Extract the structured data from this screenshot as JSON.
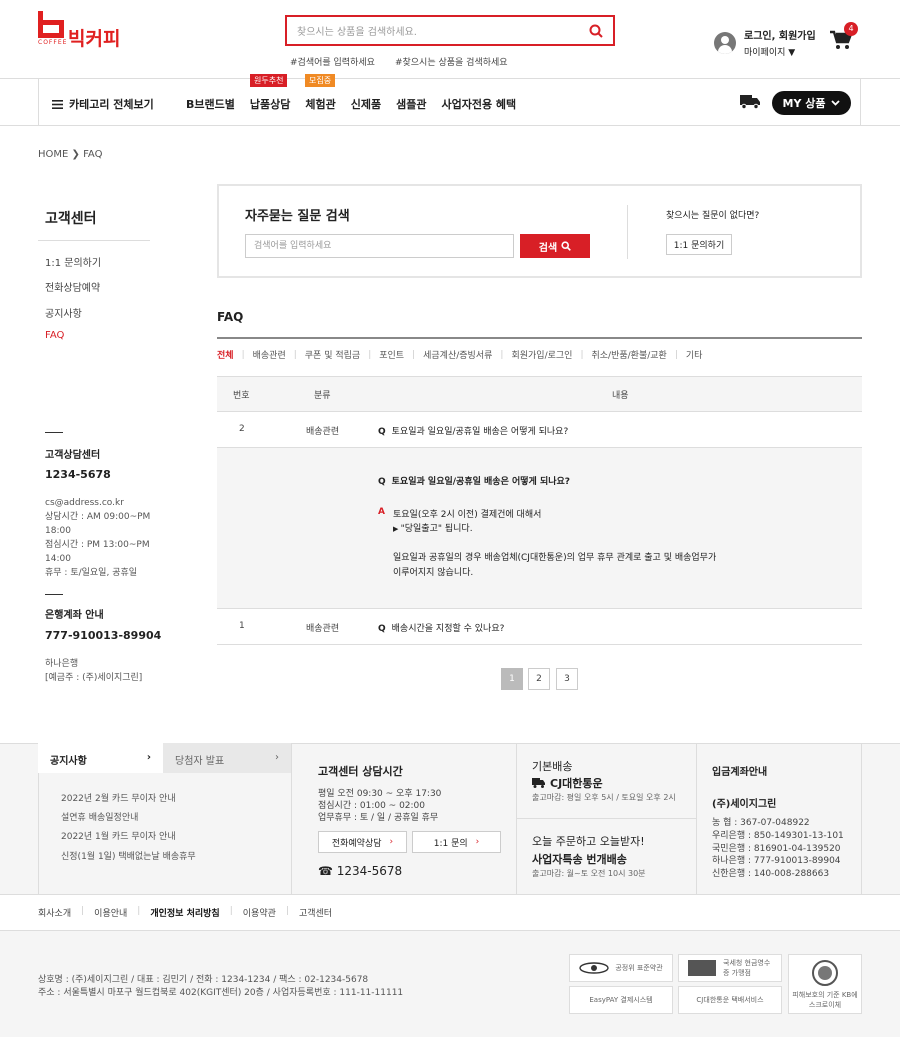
{
  "header": {
    "logo_sub": "COFFEE",
    "logo_name": "빅커피",
    "search_placeholder": "찾으시는 상품을 검색하세요.",
    "tag1": "#검색어를 입력하세요",
    "tag2": "#찾으시는 상품을 검색하세요",
    "login": "로그인, 회원가입",
    "mypage": "마이페이지 ▼",
    "cart_count": "4"
  },
  "nav": {
    "category_all": "카테고리 전체보기",
    "items": [
      "B브랜드별",
      "납품상담",
      "체험관",
      "신제품",
      "샘플관",
      "사업자전용 혜택"
    ],
    "badge1": "원두추천",
    "badge2": "모집중",
    "my": "MY 상품"
  },
  "breadcrumb": "HOME  ❯  FAQ",
  "sidebar": {
    "title": "고객센터",
    "items": [
      "1:1 문의하기",
      "전화상담예약",
      "공지사항",
      "FAQ"
    ],
    "cs_title": "고객상담센터",
    "cs_phone": "1234-5678",
    "cs_email": "cs@address.co.kr",
    "cs_hours1": "상담시간 : AM 09:00~PM 18:00",
    "cs_hours2": "점심시간 : PM 13:00~PM 14:00",
    "cs_holiday": "휴무 : 토/일요일, 공휴일",
    "bank_title": "은행계좌 안내",
    "bank_no": "777-910013-89904",
    "bank_name": "하나은행",
    "bank_holder": "[예금주 : (주)세이지그린]"
  },
  "faq_search": {
    "title": "자주묻는 질문 검색",
    "placeholder": "검색어를 입력하세요",
    "btn": "검색",
    "q": "찾으시는 질문이 없다면?",
    "ask": "1:1 문의하기"
  },
  "faq": {
    "title": "FAQ",
    "tabs": [
      "전체",
      "배송관련",
      "쿠폰 및 적립금",
      "포인트",
      "세금계산/증빙서류",
      "회원가입/로그인",
      "취소/반품/환불/교환",
      "기타"
    ],
    "cols": [
      "번호",
      "분류",
      "내용"
    ],
    "rows": [
      {
        "no": "2",
        "cat": "배송관련",
        "q": "토요일과 일요일/공휴일 배송은 어떻게 되나요?"
      },
      {
        "no": "1",
        "cat": "배송관련",
        "q": "배송시간을 지정할 수 있나요?"
      }
    ],
    "answer_q": "토요일과 일요일/공휴일 배송은 어떻게 되나요?",
    "answer_l1": "토요일(오후 2시 이전) 결제건에 대해서",
    "answer_l2": "\"당일출고\" 됩니다.",
    "answer_l3": "일요일과 공휴일의 경우 배송업체(CJ대한통운)의 업무 휴무 관계로 출고 및 배송업무가",
    "answer_l4": "이루어지지 않습니다.",
    "pages": [
      "1",
      "2",
      "3"
    ]
  },
  "footer": {
    "notice_tab": "공지사항",
    "winner_tab": "당첨자 발표",
    "notices": [
      "2022년 2월 카드 무이자 안내",
      "설연휴 배송일정안내",
      "2022년 1월 카드 무이자 안내",
      "신정(1월 1일) 택배없는날 배송휴무"
    ],
    "cs_title": "고객센터 상담시간",
    "cs1": "평일 오전 09:30 ~ 오후 17:30",
    "cs2": "점심시간 : 01:00 ~ 02:00",
    "cs3": "업무휴무 : 토 / 일 / 공휴일 휴무",
    "btn1": "전화예약상담",
    "btn2": "1:1 문의",
    "tel": "☎ 1234-5678",
    "ship_h": "기본배송",
    "ship_cj": "CJ대한통운",
    "ship_s": "출고마감: 평일 오후 5시 / 토요일 오후 2시",
    "ship2_h": "오늘 주문하고 오늘받자!",
    "ship2_b": "사업자특송 번개배송",
    "ship2_s": "출고마감: 월~토 오전 10시 30분",
    "acc_h": "입금계좌안내",
    "acc_co": "(주)세이지그린",
    "accounts": [
      "농       협 : 367-07-048922",
      "우리은행 : 850-149301-13-101",
      "국민은행 : 816901-04-139520",
      "하나은행 : 777-910013-89904",
      "신한은행 : 140-008-288663"
    ],
    "links": [
      "회사소개",
      "이용안내",
      "개인정보 처리방침",
      "이용약관",
      "고객센터"
    ],
    "info1": "상호명 : (주)세이지그린 / 대표 : 김민기 / 전화 : 1234-1234 / 팩스 : 02-1234-5678",
    "info2": "주소 : 서울특별시 마포구 월드컵북로 402(KGIT센터) 20층 / 사업자등록번호 : 111-11-11111",
    "badges": [
      "공정위 표준약관",
      "국세청 현금영수증 가맹점",
      "EasyPAY 결제시스템",
      "CJ대한통운 택배서비스",
      "피해보호의 기준 KB에스크로이체"
    ]
  },
  "colors": {
    "accent": "#d81f26"
  }
}
